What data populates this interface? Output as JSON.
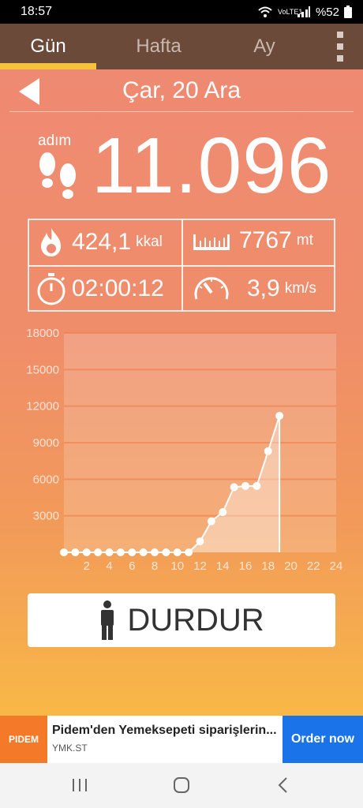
{
  "status": {
    "time": "18:57",
    "network": "VoLTE1",
    "battery": "%52"
  },
  "tabs": [
    {
      "label": "Gün",
      "active": true
    },
    {
      "label": "Hafta",
      "active": false
    },
    {
      "label": "Ay",
      "active": false
    }
  ],
  "date": "Çar, 20 Ara",
  "steps": {
    "label": "adım",
    "value": "11.096"
  },
  "stats": {
    "calories": {
      "value": "424,1",
      "unit": "kkal",
      "icon": "flame-icon"
    },
    "distance": {
      "value": "7767",
      "unit": "mt",
      "icon": "ruler-icon"
    },
    "duration": {
      "value": "02:00:12",
      "icon": "stopwatch-icon"
    },
    "speed": {
      "value": "3,9",
      "unit": "km/s",
      "icon": "speedometer-icon"
    }
  },
  "chart_data": {
    "type": "area",
    "x": [
      0,
      1,
      2,
      3,
      4,
      5,
      6,
      7,
      8,
      9,
      10,
      11,
      12,
      13,
      14,
      15,
      16,
      17,
      18,
      19
    ],
    "values": [
      0,
      0,
      0,
      0,
      0,
      0,
      0,
      0,
      0,
      0,
      0,
      0,
      900,
      2550,
      3300,
      5350,
      5450,
      5450,
      8300,
      11200
    ],
    "xticks": [
      "2",
      "4",
      "6",
      "8",
      "10",
      "12",
      "14",
      "16",
      "18",
      "20",
      "22",
      "24"
    ],
    "yticks": [
      "3000",
      "6000",
      "9000",
      "12000",
      "15000",
      "18000"
    ],
    "xlim": [
      0,
      24
    ],
    "ylim": [
      0,
      18000
    ],
    "grid": true
  },
  "stop_button": {
    "label": "DURDUR",
    "icon": "person-icon"
  },
  "ad": {
    "logo": "PIDEM",
    "title": "Pidem'den Yemeksepeti siparişlerin...",
    "subtitle": "YMK.ST",
    "cta": "Order now"
  },
  "colors": {
    "tabbar": "#6b4a3a",
    "tab_indicator": "#f6c23b",
    "gradient_top": "#ef8a72",
    "gradient_bottom": "#f8b846"
  }
}
